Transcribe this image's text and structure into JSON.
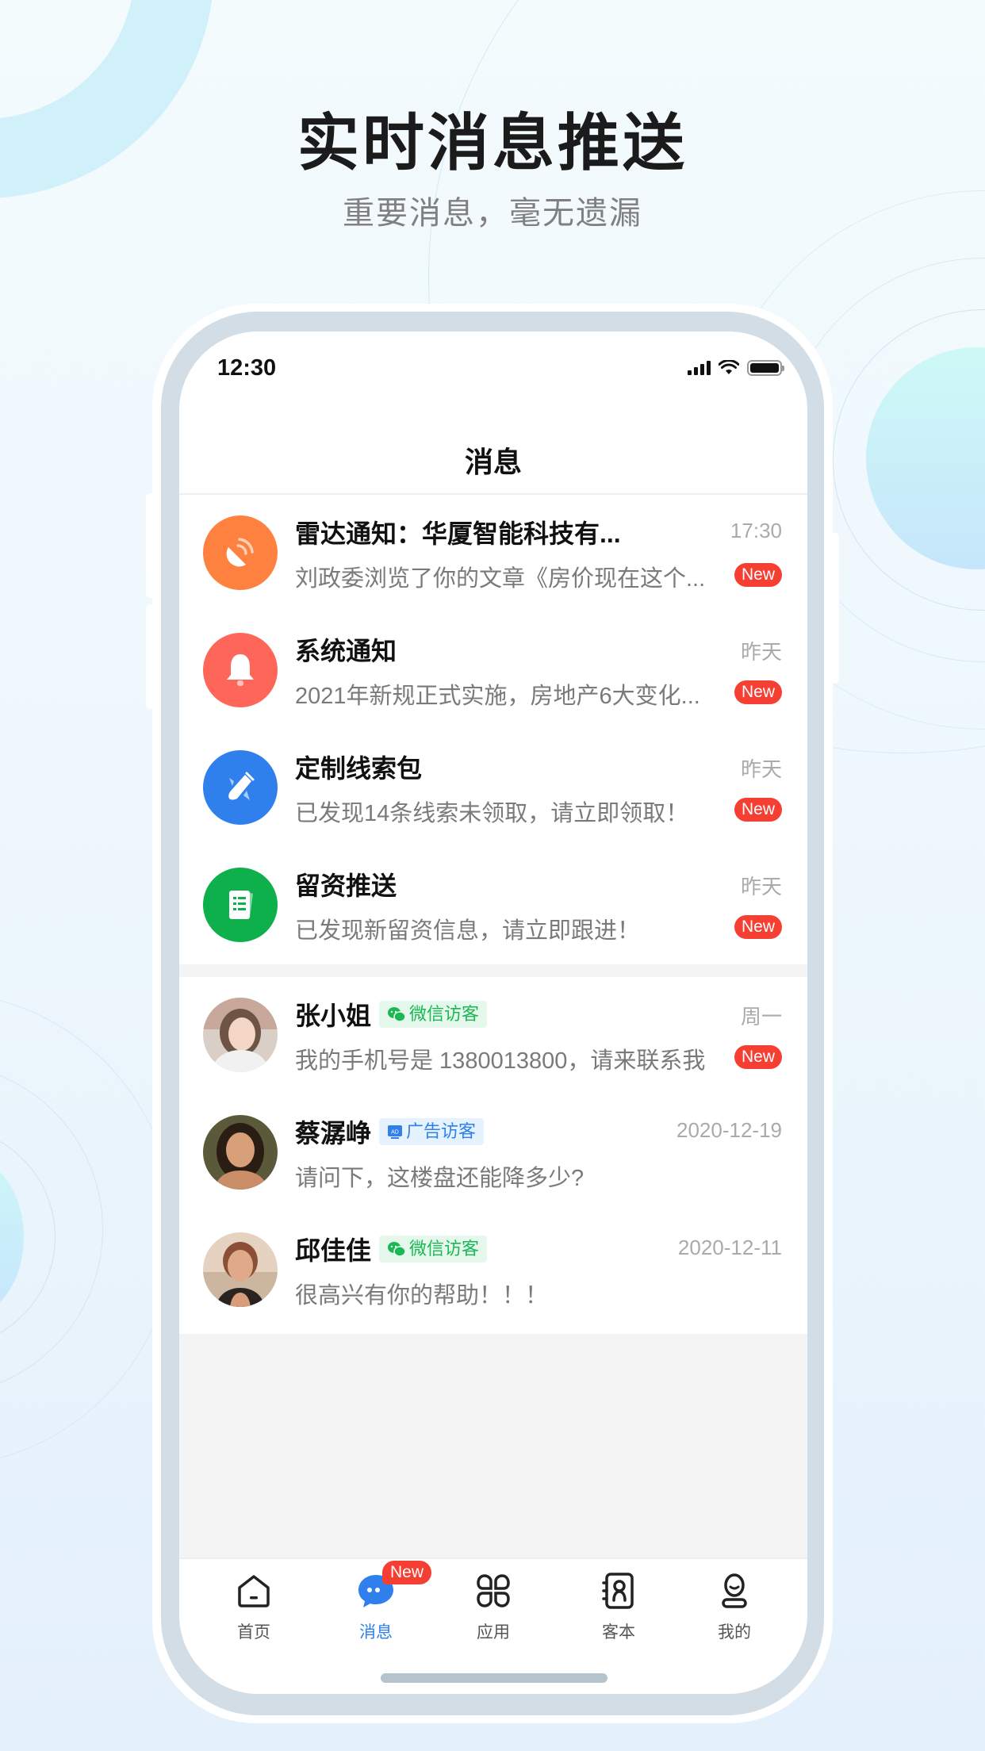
{
  "hero": {
    "title": "实时消息推送",
    "subtitle": "重要消息，毫无遗漏"
  },
  "status_bar": {
    "time": "12:30",
    "signal_icon": "cellular-signal-icon",
    "wifi_icon": "wifi-icon",
    "battery_icon": "battery-icon"
  },
  "nav": {
    "title": "消息"
  },
  "colors": {
    "accent_blue": "#2F80ED",
    "badge_red": "#F53F32",
    "radar_orange": "#FF8140",
    "system_red": "#FF665A",
    "clue_blue": "#2F80ED",
    "lead_green": "#0DB04B",
    "wechat_green": "#1AB854"
  },
  "system_messages": [
    {
      "icon": "radar-icon",
      "title": "雷达通知：华厦智能科技有...",
      "subtitle": "刘政委浏览了你的文章《房价现在这个...",
      "time": "17:30",
      "badge": "New"
    },
    {
      "icon": "bell-icon",
      "title": "系统通知",
      "subtitle": "2021年新规正式实施，房地产6大变化...",
      "time": "昨天",
      "badge": "New"
    },
    {
      "icon": "rocket-icon",
      "title": "定制线索包",
      "subtitle": "已发现14条线索未领取，请立即领取！",
      "time": "昨天",
      "badge": "New"
    },
    {
      "icon": "document-list-icon",
      "title": "留资推送",
      "subtitle": "已发现新留资信息，请立即跟进！",
      "time": "昨天",
      "badge": "New"
    }
  ],
  "chat_messages": [
    {
      "name": "张小姐",
      "tag": "微信访客",
      "tag_type": "wechat",
      "subtitle": "我的手机号是 1380013800，请来联系我",
      "time": "周一",
      "badge": "New"
    },
    {
      "name": "蔡潺峥",
      "tag": "广告访客",
      "tag_type": "ad",
      "tag_icon_text": "AD",
      "subtitle": "请问下，这楼盘还能降多少?",
      "time": "2020-12-19",
      "badge": null
    },
    {
      "name": "邱佳佳",
      "tag": "微信访客",
      "tag_type": "wechat",
      "subtitle": "很高兴有你的帮助！！！",
      "time": "2020-12-11",
      "badge": null
    }
  ],
  "tabbar": {
    "items": [
      {
        "label": "首页",
        "icon": "home-icon",
        "active": false
      },
      {
        "label": "消息",
        "icon": "chat-bubble-icon",
        "active": true,
        "badge": "New"
      },
      {
        "label": "应用",
        "icon": "apps-grid-icon",
        "active": false
      },
      {
        "label": "客本",
        "icon": "contact-book-icon",
        "active": false
      },
      {
        "label": "我的",
        "icon": "profile-icon",
        "active": false
      }
    ]
  }
}
